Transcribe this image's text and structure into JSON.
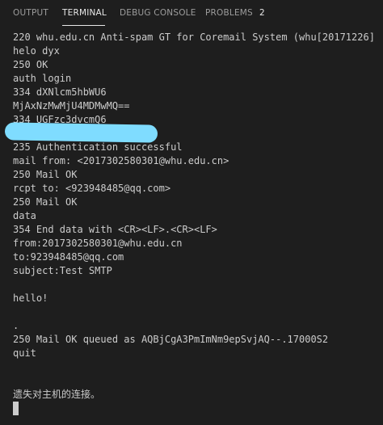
{
  "panel": {
    "tabs": [
      "OUTPUT",
      "TERMINAL",
      "DEBUG CONSOLE",
      "PROBLEMS"
    ],
    "active_tab": "TERMINAL",
    "problems_count": "2"
  },
  "terminal": {
    "lines": [
      "220 whu.edu.cn Anti-spam GT for Coremail System (whu[20171226])",
      "helo dyx",
      "250 OK",
      "auth login",
      "334 dXNlcm5hbWU6",
      "MjAxNzMwMjU4MDMwMQ==",
      "334 UGFzc3dvcmQ6",
      "",
      "235 Authentication successful",
      "mail from: <2017302580301@whu.edu.cn>",
      "250 Mail OK",
      "rcpt to: <923948485@qq.com>",
      "250 Mail OK",
      "data",
      "354 End data with <CR><LF>.<CR><LF>",
      "from:2017302580301@whu.edu.cn",
      "to:923948485@qq.com",
      "subject:Test SMTP",
      "",
      "hello!",
      "",
      ".",
      "250 Mail OK queued as AQBjCgA3PmImNm9epSvjAQ--.17000S2",
      "quit",
      "",
      "",
      "遗失对主机的连接。"
    ]
  },
  "colors": {
    "background": "#1e1e1e",
    "text": "#cccccc",
    "redaction": "#7fdcff"
  }
}
